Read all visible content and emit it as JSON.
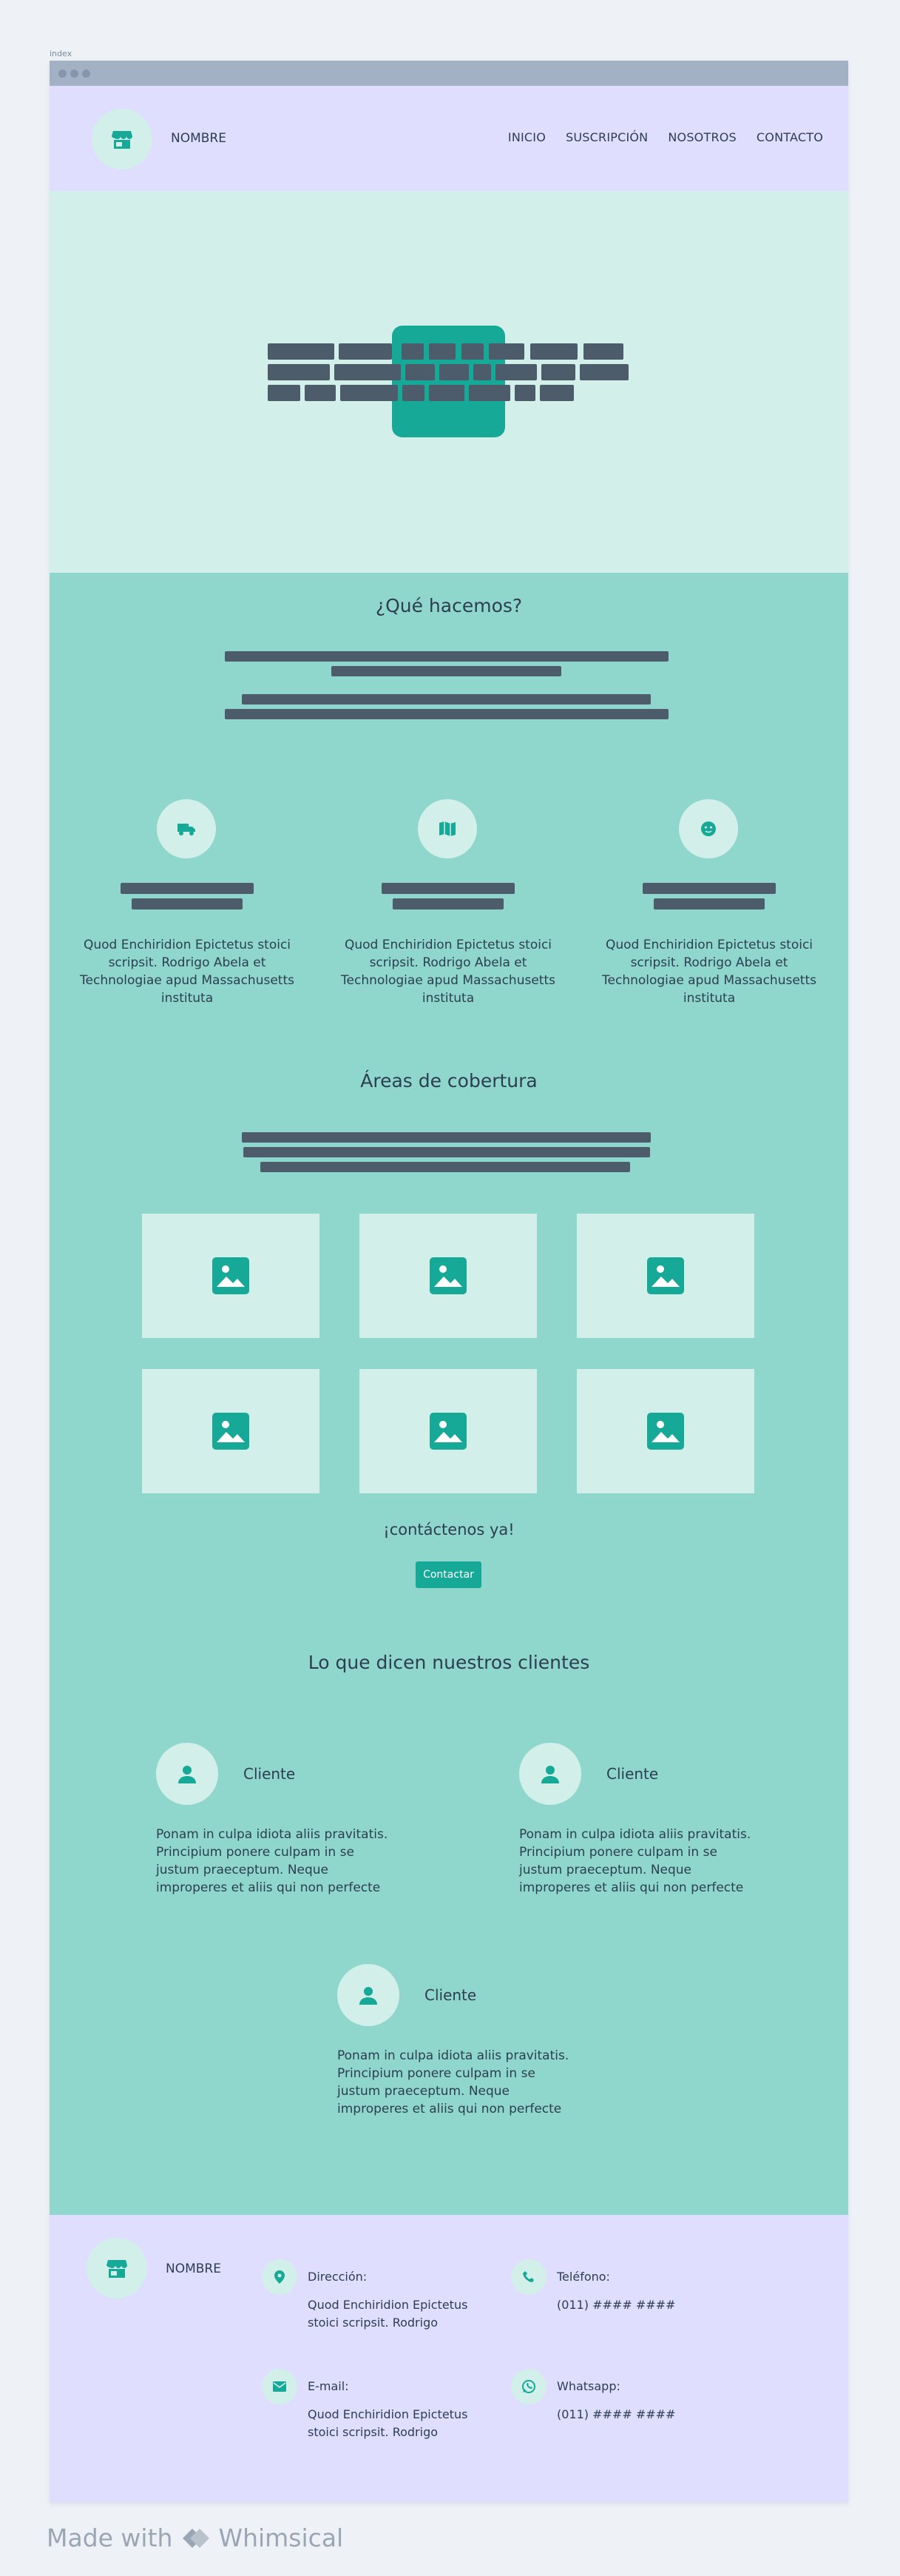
{
  "caption": "index",
  "header": {
    "brand": "NOMBRE",
    "nav": [
      "INICIO",
      "SUSCRIPCIÓN",
      "NOSOTROS",
      "CONTACTO"
    ]
  },
  "about": {
    "title": "¿Qué hacemos?",
    "features": [
      {
        "icon": "truck-icon",
        "desc": "Quod Enchiridion Epictetus stoici scripsit. Rodrigo Abela et Technologiae apud Massachusetts instituta"
      },
      {
        "icon": "map-icon",
        "desc": "Quod Enchiridion Epictetus stoici scripsit. Rodrigo Abela et Technologiae apud Massachusetts instituta"
      },
      {
        "icon": "smile-icon",
        "desc": "Quod Enchiridion Epictetus stoici scripsit. Rodrigo Abela et Technologiae apud Massachusetts instituta"
      }
    ]
  },
  "coverage": {
    "title": "Áreas de cobertura",
    "cta_text": "¡contáctenos ya!",
    "cta_button": "Contactar"
  },
  "testimonials": {
    "title": "Lo que dicen nuestros clientes",
    "items": [
      {
        "name": "Cliente",
        "quote": "Ponam in culpa idiota aliis pravitatis. Principium ponere culpam in se justum praeceptum. Neque improperes et aliis qui non perfecte"
      },
      {
        "name": "Cliente",
        "quote": "Ponam in culpa idiota aliis pravitatis. Principium ponere culpam in se justum praeceptum. Neque improperes et aliis qui non perfecte"
      },
      {
        "name": "Cliente",
        "quote": "Ponam in culpa idiota aliis pravitatis. Principium ponere culpam in se justum praeceptum. Neque improperes et aliis qui non perfecte"
      }
    ]
  },
  "footer": {
    "brand": "NOMBRE",
    "address_label": "Dirección:",
    "address_value": "Quod Enchiridion Epictetus stoici scripsit. Rodrigo",
    "phone_label": "Teléfono:",
    "phone_value": "(011) #### ####",
    "email_label": "E-mail:",
    "email_value": "Quod Enchiridion Epictetus stoici scripsit. Rodrigo",
    "whatsapp_label": "Whatsapp:",
    "whatsapp_value": "(011) #### ####"
  },
  "watermark": {
    "text_prefix": "Made with",
    "brand": "Whimsical"
  },
  "colors": {
    "accent": "#17a998",
    "mint": "#d2efea",
    "teal_bg": "#8fd7cd",
    "lavender": "#dfdeff",
    "redaction": "#4d5c6b"
  }
}
